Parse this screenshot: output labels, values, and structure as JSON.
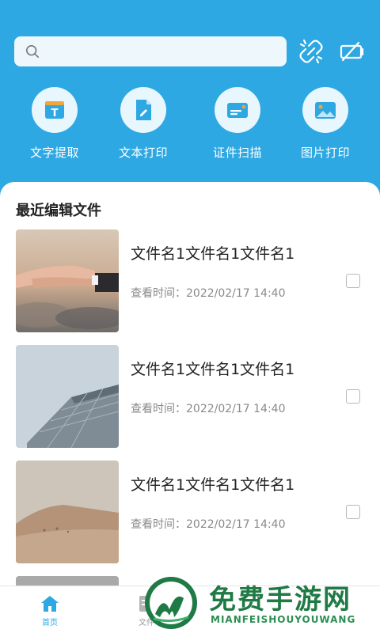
{
  "search": {
    "placeholder": ""
  },
  "top_actions": [
    {
      "icon": "unlink-icon"
    },
    {
      "icon": "battery-off-icon"
    }
  ],
  "tools": [
    {
      "label": "文字提取",
      "icon": "text-extract-icon"
    },
    {
      "label": "文本打印",
      "icon": "document-print-icon"
    },
    {
      "label": "证件扫描",
      "icon": "id-card-scan-icon"
    },
    {
      "label": "图片打印",
      "icon": "image-print-icon"
    }
  ],
  "recent": {
    "title": "最近编辑文件",
    "items": [
      {
        "name": "文件名1文件名1文件名1",
        "time": "查看时间：2022/02/17  14:40",
        "thumb": "hands-photo"
      },
      {
        "name": "文件名1文件名1文件名1",
        "time": "查看时间：2022/02/17  14:40",
        "thumb": "building-photo"
      },
      {
        "name": "文件名1文件名1文件名1",
        "time": "查看时间：2022/02/17  14:40",
        "thumb": "desert-photo"
      }
    ]
  },
  "tabbar": {
    "items": [
      {
        "label": "首页",
        "icon": "home-icon",
        "active": true
      },
      {
        "label": "文件",
        "icon": "file-icon",
        "active": false
      }
    ]
  },
  "watermark": {
    "title": "免费手游网",
    "subtitle": "MIANFEISHOUYOUWANG"
  },
  "colors": {
    "primary": "#2ea8e3",
    "sheet": "#ffffff",
    "watermark_green": "#1f7a45"
  }
}
